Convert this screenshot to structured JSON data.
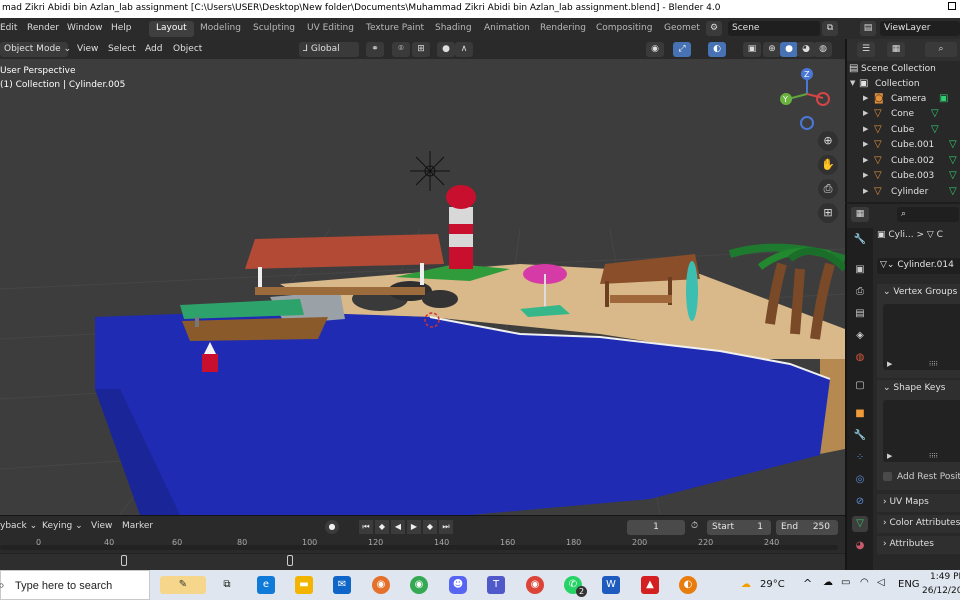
{
  "window": {
    "title": "mad Zikri Abidi bin Azlan_lab assignment [C:\\Users\\USER\\Desktop\\New folder\\Documents\\Muhammad Zikri Abidi bin Azlan_lab assignment.blend] - Blender 4.0"
  },
  "menubar": {
    "items": [
      "Edit",
      "Render",
      "Window",
      "Help"
    ],
    "workspaces": [
      "Layout",
      "Modeling",
      "Sculpting",
      "UV Editing",
      "Texture Paint",
      "Shading",
      "Animation",
      "Rendering",
      "Compositing",
      "Geomet"
    ],
    "active_workspace": "Layout",
    "scene": "Scene",
    "view_layer": "ViewLayer"
  },
  "viewport_header": {
    "mode": "Object Mode",
    "menus": [
      "View",
      "Select",
      "Add",
      "Object"
    ],
    "orientation": "Global"
  },
  "viewport": {
    "perspective": "User Perspective",
    "collection_info": "(1) Collection | Cylinder.005",
    "gizmo_axes": [
      "Z",
      "Y",
      "X"
    ]
  },
  "timeline": {
    "playback": "yback",
    "keying": "Keying",
    "view": "View",
    "marker": "Marker",
    "current_frame": "1",
    "start_label": "Start",
    "start_value": "1",
    "end_label": "End",
    "end_value": "250",
    "ticks": [
      "0",
      "40",
      "60",
      "80",
      "100",
      "120",
      "140",
      "160",
      "180",
      "200",
      "220",
      "240"
    ]
  },
  "outliner": {
    "root": "Scene Collection",
    "collection": "Collection",
    "items": [
      "Camera",
      "Cone",
      "Cube",
      "Cube.001",
      "Cube.002",
      "Cube.003",
      "Cylinder"
    ]
  },
  "properties": {
    "breadcrumb_object": "Cyli...",
    "breadcrumb_sep": ">",
    "breadcrumb_mesh": "C",
    "mesh_name": "Cylinder.014",
    "panels": {
      "vertex_groups": "Vertex Groups",
      "shape_keys": "Shape Keys",
      "add_rest_position": "Add Rest Positio",
      "uv_maps": "UV Maps",
      "color_attributes": "Color Attributes",
      "attributes": "Attributes"
    }
  },
  "taskbar": {
    "search_placeholder": "Type here to search",
    "weather": "29°C",
    "language": "ENG",
    "time": "1:49 PM",
    "date": "26/12/20",
    "whatsapp_badge": "2"
  }
}
